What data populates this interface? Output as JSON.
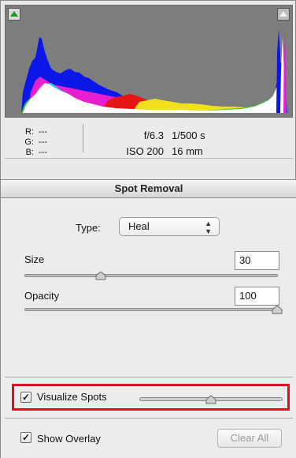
{
  "histogram": {
    "shadow_clip_icon": "triangle-up-icon",
    "highlight_clip_icon": "triangle-up-icon"
  },
  "readout": {
    "r_label": "R:",
    "r_value": "---",
    "g_label": "G:",
    "g_value": "---",
    "b_label": "B:",
    "b_value": "---",
    "aperture": "f/6.3",
    "shutter": "1/500 s",
    "iso": "ISO 200",
    "focal": "16 mm"
  },
  "section": {
    "title": "Spot Removal"
  },
  "type": {
    "label": "Type:",
    "value": "Heal"
  },
  "size": {
    "label": "Size",
    "value": "30",
    "level": 0.3
  },
  "opacity": {
    "label": "Opacity",
    "value": "100",
    "level": 1.0
  },
  "visualize": {
    "label": "Visualize Spots",
    "checked": true,
    "level": 0.5
  },
  "overlay": {
    "label": "Show Overlay",
    "checked": true
  },
  "clear_all": {
    "label": "Clear All"
  },
  "colors": {
    "highlight_border": "#e0101a"
  }
}
